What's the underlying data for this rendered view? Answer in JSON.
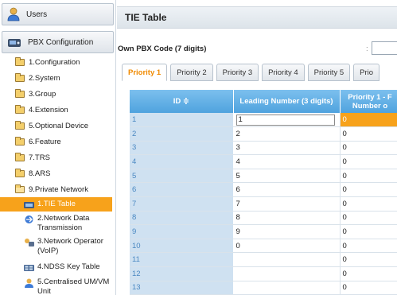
{
  "sidebar": {
    "users_label": "Users",
    "pbx_label": "PBX Configuration",
    "tree": [
      {
        "label": "1.Configuration"
      },
      {
        "label": "2.System"
      },
      {
        "label": "3.Group"
      },
      {
        "label": "4.Extension"
      },
      {
        "label": "5.Optional Device"
      },
      {
        "label": "6.Feature"
      },
      {
        "label": "7.TRS"
      },
      {
        "label": "8.ARS"
      },
      {
        "label": "9.Private Network"
      }
    ],
    "subitems": [
      {
        "label": "1.TIE Table"
      },
      {
        "label": "2.Network Data Transmission"
      },
      {
        "label": "3.Network Operator (VoIP)"
      },
      {
        "label": "4.NDSS Key Table"
      },
      {
        "label": "5.Centralised UM/VM Unit"
      }
    ]
  },
  "main": {
    "title": "TIE Table",
    "own_code_label": "Own PBX Code (7 digits)",
    "own_code_colon": ":",
    "own_code_value": ""
  },
  "tabs": [
    "Priority 1",
    "Priority 2",
    "Priority 3",
    "Priority 4",
    "Priority 5",
    "Prio"
  ],
  "table": {
    "headers": {
      "id": "ID ≑",
      "leading": "Leading Number (3 digits)",
      "priority_line1": "Priority 1 - F",
      "priority_line2": "Number o"
    },
    "rows": [
      {
        "id": "1",
        "leading": "1",
        "priority": "0"
      },
      {
        "id": "2",
        "leading": "2",
        "priority": "0"
      },
      {
        "id": "3",
        "leading": "3",
        "priority": "0"
      },
      {
        "id": "4",
        "leading": "4",
        "priority": "0"
      },
      {
        "id": "5",
        "leading": "5",
        "priority": "0"
      },
      {
        "id": "6",
        "leading": "6",
        "priority": "0"
      },
      {
        "id": "7",
        "leading": "7",
        "priority": "0"
      },
      {
        "id": "8",
        "leading": "8",
        "priority": "0"
      },
      {
        "id": "9",
        "leading": "9",
        "priority": "0"
      },
      {
        "id": "10",
        "leading": "0",
        "priority": "0"
      },
      {
        "id": "11",
        "leading": "",
        "priority": "0"
      },
      {
        "id": "12",
        "leading": "",
        "priority": "0"
      },
      {
        "id": "13",
        "leading": "",
        "priority": "0"
      }
    ]
  },
  "colors": {
    "accent_orange": "#f7a21b",
    "header_blue": "#4fa3de",
    "id_cell_blue": "#cfe1f1"
  }
}
